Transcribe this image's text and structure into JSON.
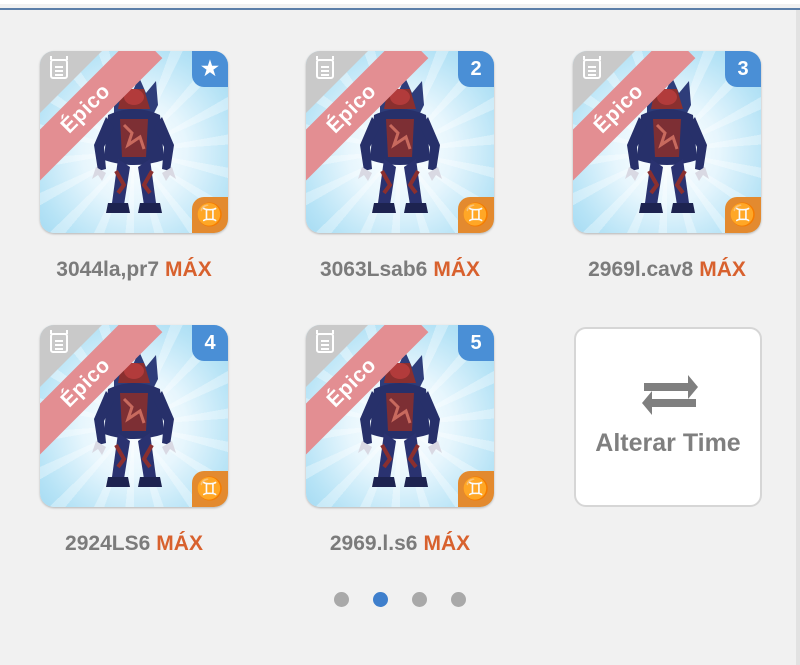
{
  "cards": [
    {
      "rarity": "Épico",
      "badge": "★",
      "name": "3044la,pr7",
      "level": "MÁX"
    },
    {
      "rarity": "Épico",
      "badge": "2",
      "name": "3063Lsab6",
      "level": "MÁX"
    },
    {
      "rarity": "Épico",
      "badge": "3",
      "name": "2969l.cav8",
      "level": "MÁX"
    },
    {
      "rarity": "Épico",
      "badge": "4",
      "name": "2924LS6",
      "level": "MÁX"
    },
    {
      "rarity": "Épico",
      "badge": "5",
      "name": "2969.l.s6",
      "level": "MÁX"
    }
  ],
  "element_symbol": "♊",
  "change_team_label": "Alterar Time",
  "pagination": {
    "pages": 4,
    "current": 2
  },
  "colors": {
    "rarity_ribbon": "#e38e92",
    "number_badge": "#4a8fd6",
    "element_badge": "#e38a2f",
    "max_text": "#d8612e",
    "dot_active": "#3f7fcc"
  }
}
